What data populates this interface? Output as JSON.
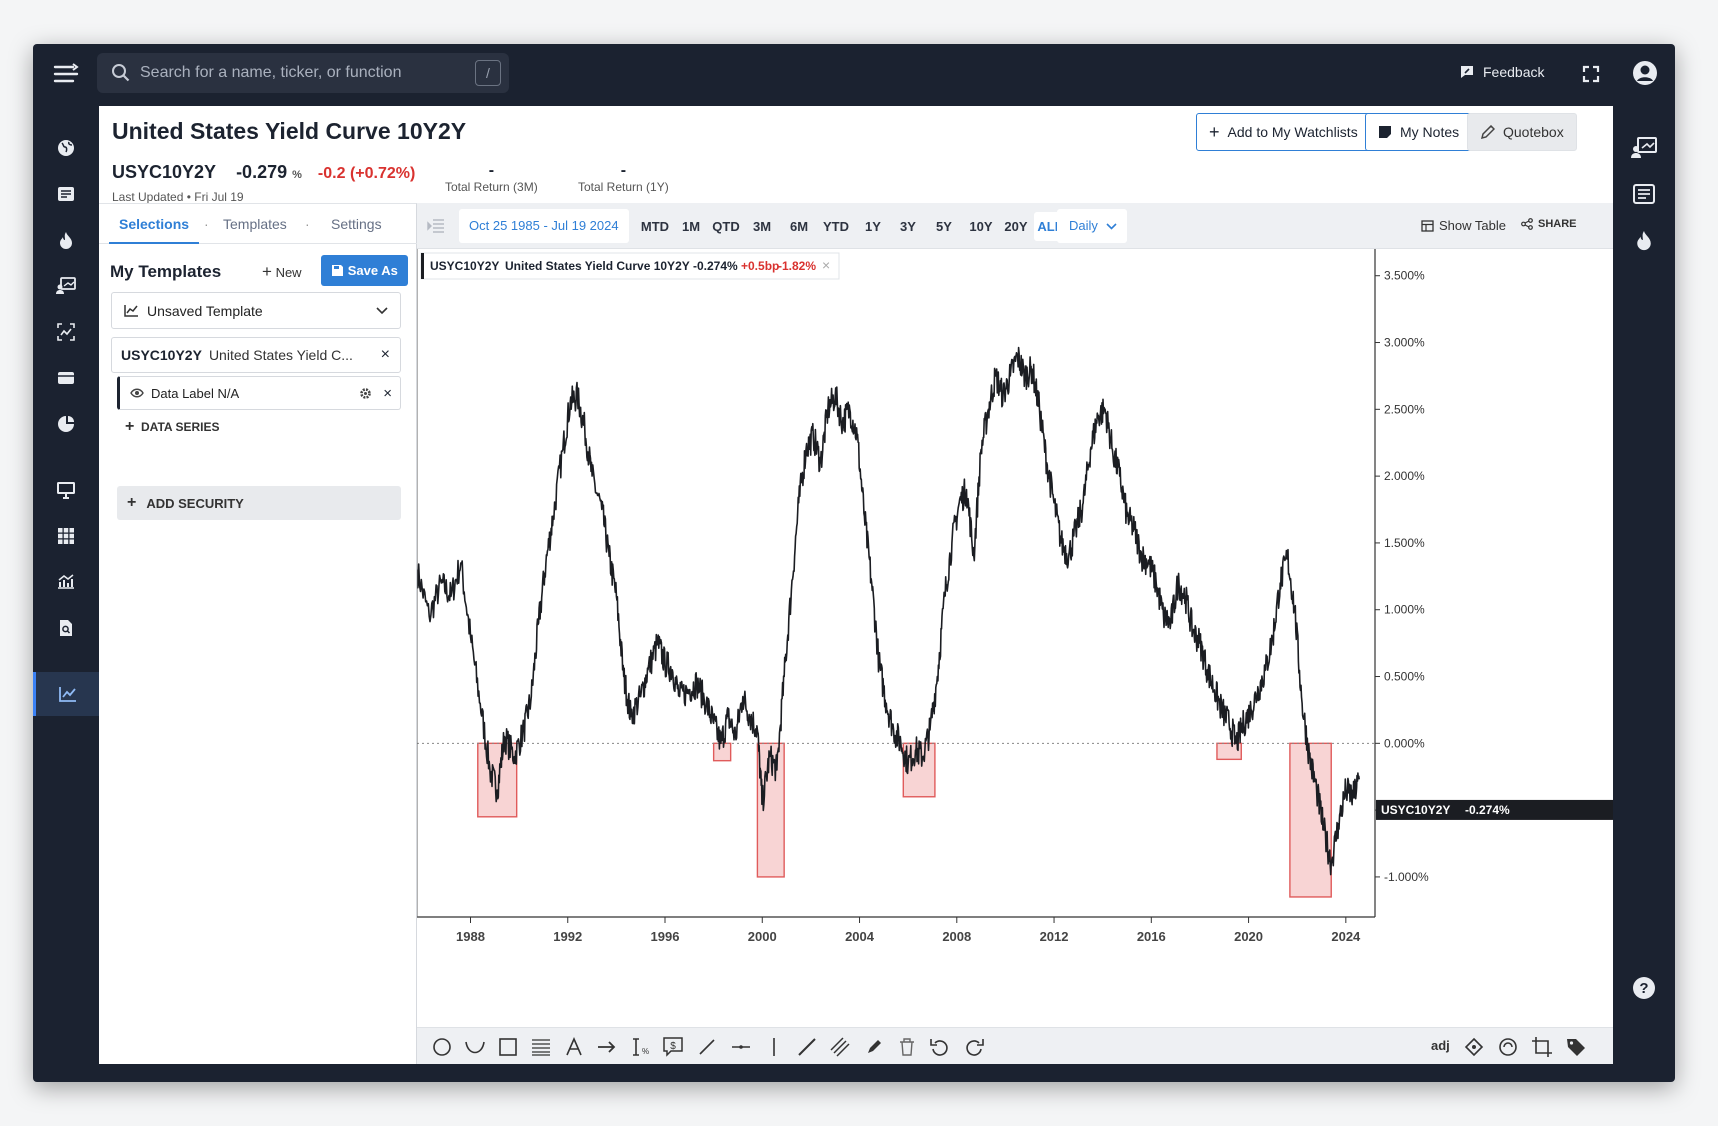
{
  "search": {
    "placeholder": "Search for a name, ticker, or function",
    "shortcut": "/"
  },
  "topbar": {
    "feedback_label": "Feedback"
  },
  "header": {
    "title": "United States Yield Curve 10Y2Y",
    "buttons": {
      "watchlist": "Add to My Watchlists",
      "notes": "My Notes",
      "quotebox": "Quotebox"
    },
    "ticker": "USYC10Y2Y",
    "price": "-0.279",
    "price_unit": "%",
    "change": "-0.2",
    "change_pct": "(+0.72%)",
    "last_updated": "Last Updated • Fri Jul 19",
    "returns": [
      {
        "value": "-",
        "label": "Total Return (3M)"
      },
      {
        "value": "-",
        "label": "Total Return (1Y)"
      }
    ]
  },
  "sidebar": {
    "tabs": [
      "Selections",
      "Templates",
      "Settings"
    ],
    "my_templates": "My Templates",
    "new_label": "New",
    "save_as": "Save As",
    "template_select": "Unsaved Template",
    "security": {
      "ticker": "USYC10Y2Y",
      "name": "United States Yield C..."
    },
    "data_label": "Data Label N/A",
    "data_series": "DATA SERIES",
    "add_security": "ADD SECURITY"
  },
  "toolbar": {
    "date_range": "Oct 25 1985 - Jul 19 2024",
    "periods": [
      "MTD",
      "1M",
      "QTD",
      "3M",
      "6M",
      "YTD",
      "1Y",
      "3Y",
      "5Y",
      "10Y",
      "20Y",
      "ALL"
    ],
    "selected_period": "ALL",
    "frequency": "Daily",
    "show_table": "Show Table",
    "share": "SHARE"
  },
  "legend": {
    "ticker": "USYC10Y2Y",
    "name": "United States Yield Curve 10Y2Y",
    "value": "-0.274",
    "unit": "%",
    "chg_bp": "+0.5",
    "chg_bp_unit": "bp",
    "chg_pct": "-1.82",
    "chg_pct_unit": "%"
  },
  "price_tag": {
    "ticker": "USYC10Y2Y",
    "value": "-0.274%"
  },
  "drawbar": {
    "adj": "adj"
  },
  "colors": {
    "accent": "#2f7fd6",
    "negative": "#d9322f",
    "line": "#1b1d22",
    "highlight": "#f5c6c6",
    "rail": "#1b2230"
  },
  "chart_data": {
    "type": "line",
    "xlim": [
      1985.8,
      2025.2
    ],
    "ylim": [
      -1.3,
      3.7
    ],
    "x_ticks": [
      1988,
      1992,
      1996,
      2000,
      2004,
      2008,
      2012,
      2016,
      2020,
      2024
    ],
    "x_tick_labels": [
      "1988",
      "1992",
      "1996",
      "2000",
      "2004",
      "2008",
      "2012",
      "2016",
      "2020",
      "2024"
    ],
    "y_ticks": [
      3.5,
      3.0,
      2.5,
      2.0,
      1.5,
      1.0,
      0.5,
      0.0,
      -0.5,
      -1.0
    ],
    "y_tick_labels": [
      "3.500%",
      "3.000%",
      "2.500%",
      "2.000%",
      "1.500%",
      "1.000%",
      "0.500%",
      "0.000%",
      "-0.500%",
      "-1.000%"
    ],
    "series": [
      {
        "x": [
          1985.8,
          1986.3,
          1986.8,
          1987.2,
          1987.6,
          1988.0,
          1988.4,
          1988.8,
          1989.1,
          1989.4,
          1989.8,
          1990.2,
          1990.5,
          1990.8,
          1991.1,
          1991.4,
          1991.8,
          1992.1,
          1992.4,
          1992.7,
          1993.0,
          1993.4,
          1993.7,
          1994.0,
          1994.3,
          1994.6,
          1995.0,
          1995.3,
          1995.7,
          1996.0,
          1996.3,
          1996.6,
          1997.0,
          1997.3,
          1997.7,
          1998.0,
          1998.3,
          1998.6,
          1998.9,
          1999.2,
          1999.5,
          1999.8,
          2000.0,
          2000.3,
          2000.6,
          2000.9,
          2001.2,
          2001.5,
          2001.8,
          2002.1,
          2002.4,
          2002.7,
          2003.0,
          2003.3,
          2003.6,
          2003.9,
          2004.2,
          2004.5,
          2004.8,
          2005.1,
          2005.4,
          2005.7,
          2006.0,
          2006.3,
          2006.6,
          2006.9,
          2007.2,
          2007.5,
          2007.8,
          2008.1,
          2008.4,
          2008.7,
          2009.0,
          2009.3,
          2009.6,
          2009.9,
          2010.2,
          2010.5,
          2010.8,
          2011.1,
          2011.4,
          2011.7,
          2012.0,
          2012.3,
          2012.6,
          2012.9,
          2013.2,
          2013.5,
          2013.8,
          2014.1,
          2014.4,
          2014.7,
          2015.0,
          2015.3,
          2015.6,
          2015.9,
          2016.2,
          2016.5,
          2016.8,
          2017.1,
          2017.4,
          2017.7,
          2018.0,
          2018.3,
          2018.6,
          2018.9,
          2019.2,
          2019.5,
          2019.8,
          2020.1,
          2020.4,
          2020.7,
          2021.0,
          2021.3,
          2021.6,
          2021.9,
          2022.2,
          2022.5,
          2022.8,
          2023.1,
          2023.4,
          2023.7,
          2024.0,
          2024.3,
          2024.55
        ],
        "y": [
          1.3,
          0.95,
          1.2,
          1.1,
          1.35,
          0.8,
          0.3,
          -0.2,
          -0.35,
          0.05,
          -0.1,
          0.1,
          0.35,
          0.9,
          1.35,
          1.7,
          2.2,
          2.55,
          2.6,
          2.35,
          2.0,
          1.75,
          1.4,
          1.1,
          0.5,
          0.2,
          0.35,
          0.55,
          0.75,
          0.6,
          0.55,
          0.35,
          0.4,
          0.45,
          0.3,
          0.15,
          0.0,
          0.2,
          0.05,
          0.35,
          0.2,
          0.1,
          -0.45,
          -0.1,
          -0.2,
          0.5,
          1.15,
          1.8,
          2.2,
          2.3,
          2.1,
          2.5,
          2.6,
          2.4,
          2.5,
          2.3,
          1.7,
          1.2,
          0.6,
          0.3,
          0.1,
          0.0,
          -0.15,
          -0.05,
          -0.1,
          0.1,
          0.5,
          1.1,
          1.5,
          1.8,
          1.9,
          1.4,
          2.2,
          2.5,
          2.75,
          2.6,
          2.75,
          2.9,
          2.75,
          2.8,
          2.5,
          2.1,
          1.8,
          1.5,
          1.4,
          1.6,
          1.8,
          2.2,
          2.45,
          2.5,
          2.2,
          2.0,
          1.7,
          1.6,
          1.4,
          1.35,
          1.2,
          0.95,
          0.9,
          1.2,
          1.1,
          0.85,
          0.75,
          0.55,
          0.4,
          0.25,
          0.15,
          0.0,
          0.15,
          0.25,
          0.4,
          0.55,
          0.8,
          1.2,
          1.4,
          1.0,
          0.3,
          -0.1,
          -0.35,
          -0.65,
          -0.9,
          -0.6,
          -0.35,
          -0.4,
          -0.27
        ]
      }
    ]
  }
}
